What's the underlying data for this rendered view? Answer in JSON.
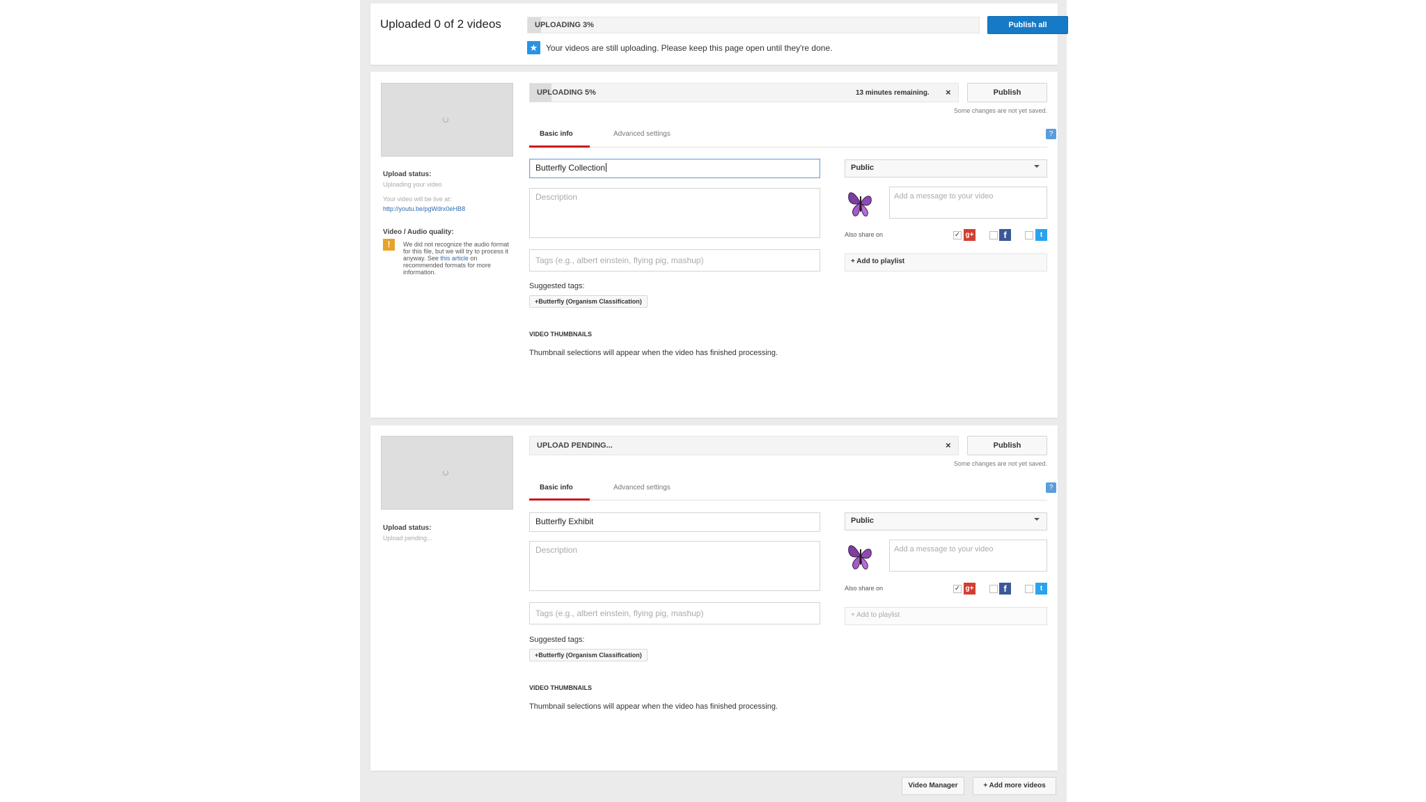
{
  "overall": {
    "title": "Uploaded 0 of 2 videos",
    "progress_label": "UPLOADING 3%",
    "progress_percent": 3,
    "publish_all_label": "Publish all",
    "notice": "Your videos are still uploading. Please keep this page open until they're done.",
    "notice_icon": "star-icon"
  },
  "videos": [
    {
      "progress_label": "UPLOADING 5%",
      "progress_percent": 5,
      "remaining": "13 minutes remaining.",
      "close_symbol": "×",
      "publish_label": "Publish",
      "unsaved": "Some changes are not yet saved.",
      "tabs": [
        "Basic info",
        "Advanced settings"
      ],
      "title_value": "Butterfly Collection",
      "description_placeholder": "Description",
      "tags_placeholder": "Tags (e.g., albert einstein, flying pig, mashup)",
      "privacy": "Public",
      "message_placeholder": "Add a message to your video",
      "also_share": "Also share on",
      "add_playlist": "+ Add to playlist",
      "suggested_label": "Suggested tags:",
      "suggested_tag": "+Butterfly (Organism Classification)",
      "thumbs_title": "VIDEO THUMBNAILS",
      "thumbs_note": "Thumbnail selections will appear when the video has finished processing.",
      "upload_status_title": "Upload status:",
      "upload_status": "Uploading your video",
      "live_at": "Your video will be live at:",
      "live_url": "http://youtu.be/pgWdrx0eHB8",
      "quality_title": "Video / Audio quality:",
      "quality_text_1": "We did not recognize the audio format for this file, but we will try to process it anyway. See ",
      "quality_link": "this article",
      "quality_text_2": " on recommended formats for more information."
    },
    {
      "progress_label": "UPLOAD PENDING...",
      "progress_percent": 0,
      "close_symbol": "×",
      "publish_label": "Publish",
      "unsaved": "Some changes are not yet saved.",
      "tabs": [
        "Basic info",
        "Advanced settings"
      ],
      "title_value": "Butterfly Exhibit",
      "description_placeholder": "Description",
      "tags_placeholder": "Tags (e.g., albert einstein, flying pig, mashup)",
      "privacy": "Public",
      "message_placeholder": "Add a message to your video",
      "also_share": "Also share on",
      "add_playlist": "+ Add to playlist",
      "suggested_label": "Suggested tags:",
      "suggested_tag": "+Butterfly (Organism Classification)",
      "thumbs_title": "VIDEO THUMBNAILS",
      "thumbs_note": "Thumbnail selections will appear when the video has finished processing.",
      "upload_status_title": "Upload status:",
      "upload_status": "Upload pending..."
    }
  ],
  "footer": {
    "video_manager": "Video Manager",
    "add_more": "+ Add more videos"
  },
  "colors": {
    "accent_blue": "#167ac6",
    "tab_red": "#cc181e",
    "warning": "#e8a22b"
  }
}
